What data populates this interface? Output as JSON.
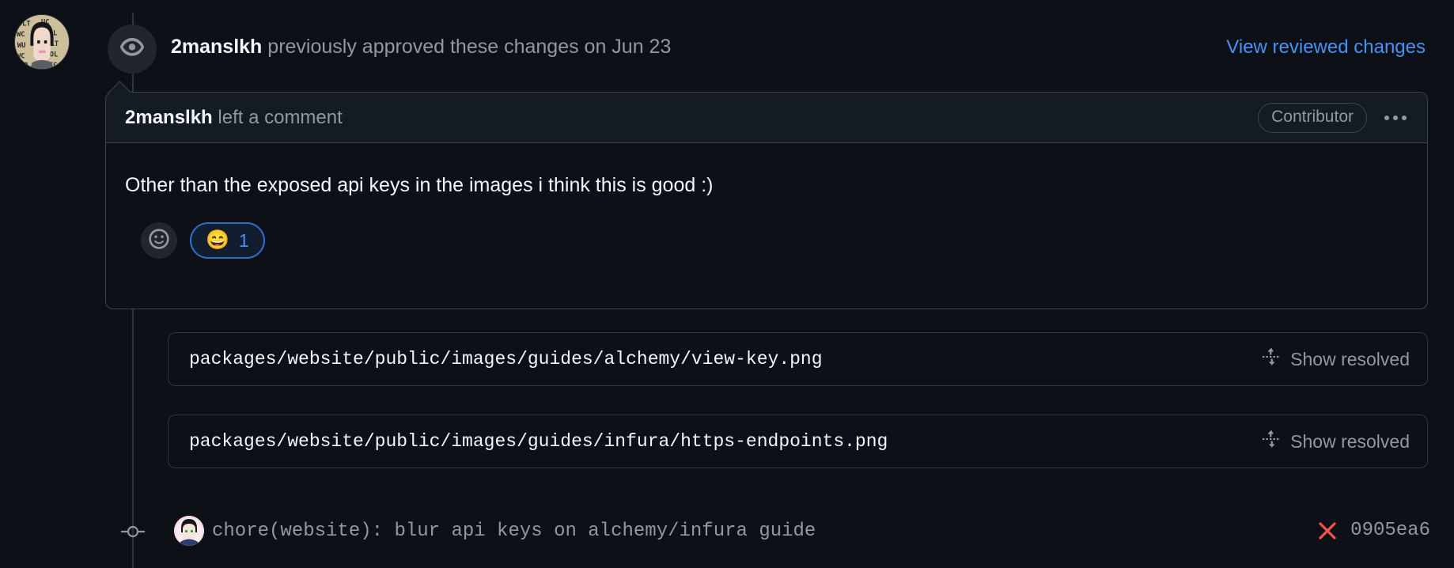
{
  "colors": {
    "page_bg": "#0d1117",
    "card_header_bg": "#151b23",
    "border": "#3d444d",
    "link_blue": "#4493f8",
    "muted_text": "#9198a1",
    "primary_text": "#f0f6fc",
    "reaction_border": "#316dca",
    "status_fail_red": "#f85149"
  },
  "review_header": {
    "avatar": "user-avatar",
    "status_icon": "eye-icon",
    "author": "2manslkh",
    "action_text": "previously approved these changes on Jun 23",
    "link_label": "View reviewed changes"
  },
  "comment": {
    "author": "2manslkh",
    "action_text": "left a comment",
    "badge": "Contributor",
    "menu_icon": "kebab-menu-icon",
    "body": "Other than the exposed api keys in the images i think this is good :)",
    "reactions": {
      "add_icon": "smiley-plus-icon",
      "items": [
        {
          "emoji": "😄",
          "name": "laugh-reaction",
          "count": "1"
        }
      ]
    }
  },
  "resolved_threads": [
    {
      "path": "packages/website/public/images/guides/alchemy/view-key.png",
      "toggle_label": "Show resolved",
      "toggle_icon": "unfold-icon"
    },
    {
      "path": "packages/website/public/images/guides/infura/https-endpoints.png",
      "toggle_label": "Show resolved",
      "toggle_icon": "unfold-icon"
    }
  ],
  "commit": {
    "node_icon": "commit-node-icon",
    "avatar": "commit-author-avatar",
    "message": "chore(website): blur api keys on alchemy/infura guide",
    "status_icon": "x-fail-icon",
    "sha": "0905ea6"
  }
}
